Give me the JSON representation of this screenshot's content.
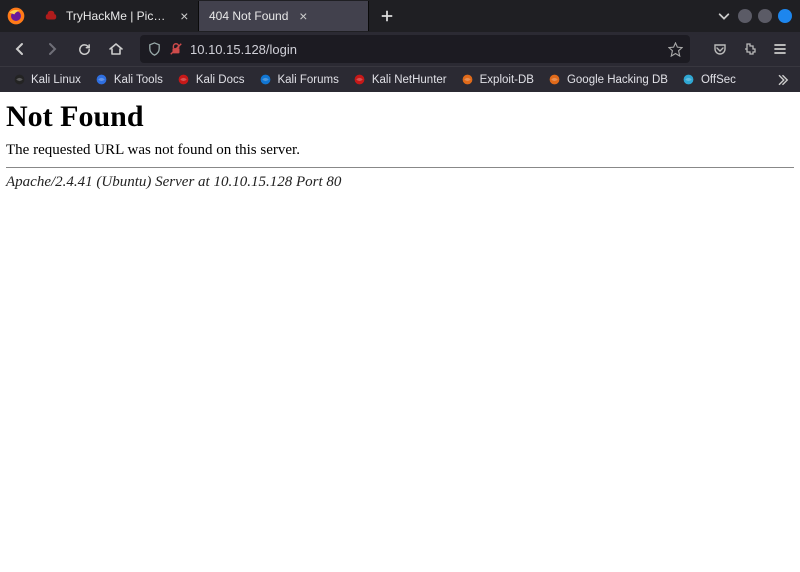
{
  "tabs": {
    "items": [
      {
        "label": "TryHackMe | Pickle Rick",
        "favicon_color": "#b01c1c"
      },
      {
        "label": "404 Not Found",
        "favicon_color": "#666"
      }
    ],
    "active_index": 1
  },
  "navbar": {
    "url": "10.10.15.128/login"
  },
  "bookmarks": {
    "items": [
      {
        "label": "Kali Linux",
        "icon_color": "#232323"
      },
      {
        "label": "Kali Tools",
        "icon_color": "#2f6fe0"
      },
      {
        "label": "Kali Docs",
        "icon_color": "#c61818"
      },
      {
        "label": "Kali Forums",
        "icon_color": "#1176d3"
      },
      {
        "label": "Kali NetHunter",
        "icon_color": "#c61818"
      },
      {
        "label": "Exploit-DB",
        "icon_color": "#e06a1a"
      },
      {
        "label": "Google Hacking DB",
        "icon_color": "#e06a1a"
      },
      {
        "label": "OffSec",
        "icon_color": "#2fa7d3"
      }
    ]
  },
  "page": {
    "heading": "Not Found",
    "message": "The requested URL was not found on this server.",
    "server_line": "Apache/2.4.41 (Ubuntu) Server at 10.10.15.128 Port 80"
  }
}
